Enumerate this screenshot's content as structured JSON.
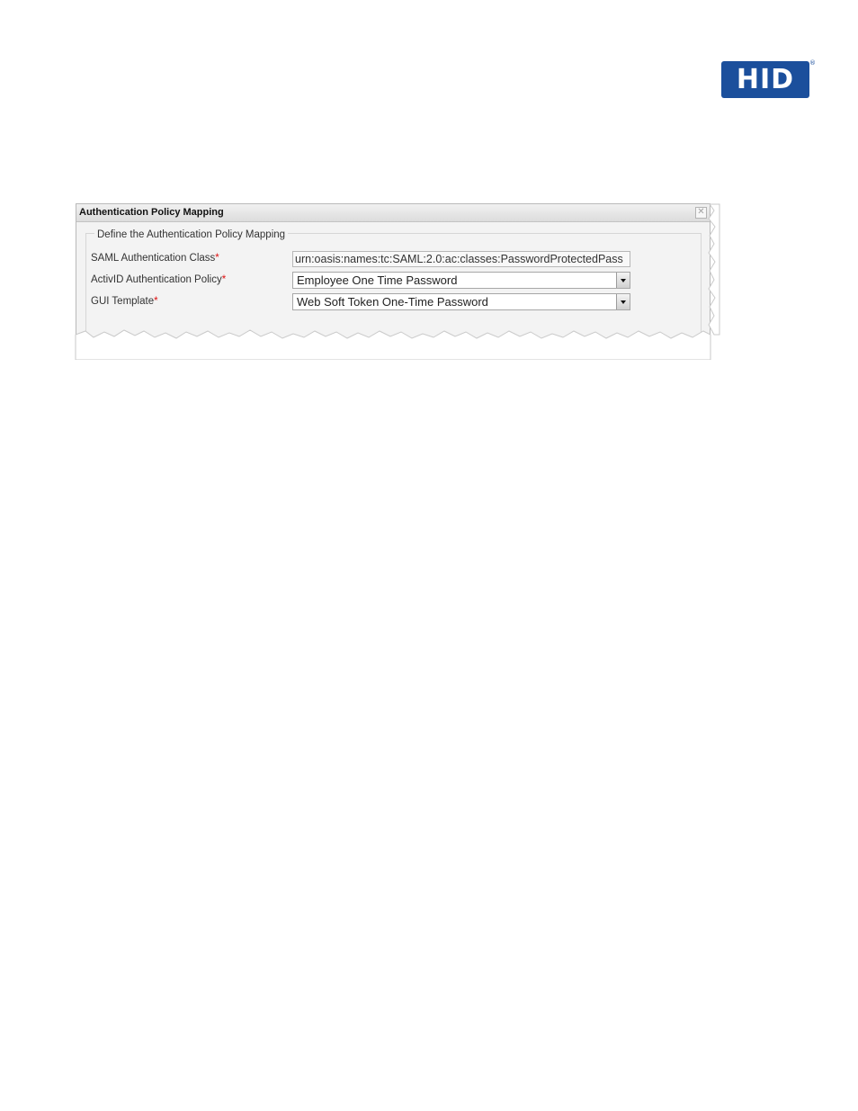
{
  "brand": {
    "logo_text": "HID",
    "logo_registered": "®",
    "color": "#1b4f9c"
  },
  "dialog": {
    "title": "Authentication Policy Mapping",
    "close_icon": "close-icon",
    "fieldset_legend": "Define the Authentication Policy Mapping",
    "required_marker": "*",
    "required_color": "#dd1111",
    "fields": [
      {
        "label": "SAML Authentication Class",
        "type": "text",
        "value": "urn:oasis:names:tc:SAML:2.0:ac:classes:PasswordProtectedPass"
      },
      {
        "label": "ActivID Authentication Policy",
        "type": "select",
        "value": "Employee One Time Password"
      },
      {
        "label": "GUI Template",
        "type": "select",
        "value": "Web Soft Token One-Time Password"
      }
    ]
  }
}
